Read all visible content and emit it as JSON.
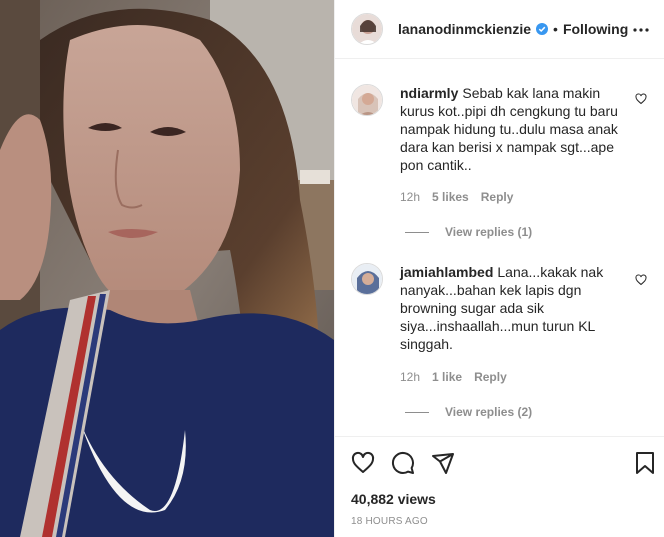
{
  "post": {
    "username": "lananodinmckienzie",
    "separator": "•",
    "follow_label": "Following",
    "verified": true
  },
  "comments": [
    {
      "username": "ndiarmly",
      "text": "Sebab kak lana makin kurus kot..pipi dh cengkung tu baru nampak hidung tu..dulu masa anak dara kan berisi x nampak sgt...ape pon cantik..",
      "time": "12h",
      "likes": "5 likes",
      "reply_label": "Reply",
      "view_replies": "View replies (1)"
    },
    {
      "username": "jamiahlambed",
      "text": "Lana...kakak nak nanyak...bahan kek lapis dgn browning sugar ada sik siya...inshaallah...mun turun KL singgah.",
      "time": "12h",
      "likes": "1 like",
      "reply_label": "Reply",
      "view_replies": "View replies (2)"
    }
  ],
  "footer": {
    "views": "40,882 views",
    "timestamp": "18 HOURS AGO"
  },
  "icons": {
    "like": "heart-icon",
    "comment": "comment-icon",
    "share": "share-icon",
    "save": "bookmark-icon",
    "more": "more-icon",
    "verified": "verified-badge-icon"
  },
  "colors": {
    "verified": "#3897f0",
    "text": "#262626",
    "muted": "#8e8e8e"
  }
}
